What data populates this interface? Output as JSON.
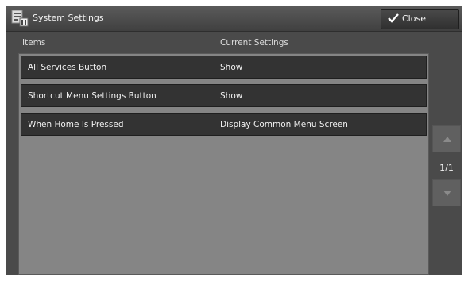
{
  "window": {
    "title": "System Settings",
    "title_icon": "system-settings-icon",
    "close_label": "Close",
    "close_icon": "checkmark-icon"
  },
  "columns": {
    "items": "Items",
    "current": "Current Settings"
  },
  "rows": [
    {
      "item": "All Services Button",
      "value": "Show"
    },
    {
      "item": "Shortcut Menu Settings Button",
      "value": "Show"
    },
    {
      "item": "When Home Is Pressed",
      "value": "Display Common Menu Screen"
    }
  ],
  "pager": {
    "indicator": "1/1"
  },
  "colors": {
    "frame": "#4a4a4a",
    "row": "#333333",
    "list_bg": "#858585",
    "text": "#f2f2f2"
  }
}
